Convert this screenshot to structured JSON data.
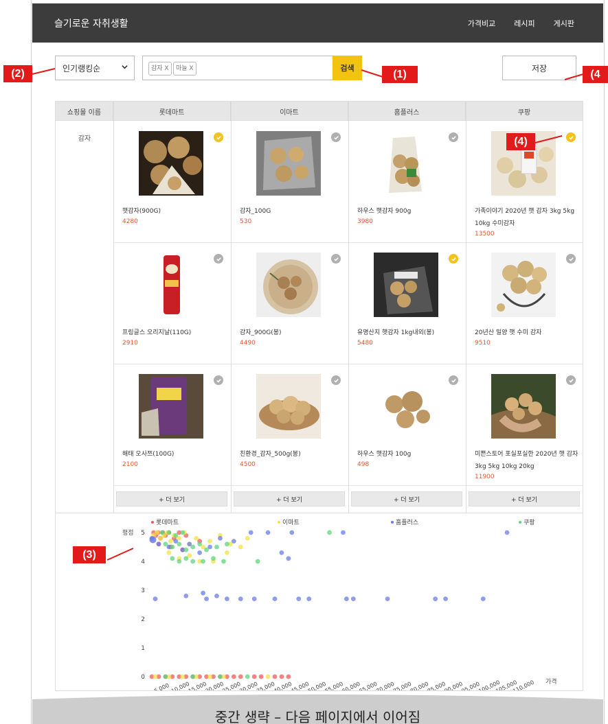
{
  "header": {
    "title": "슬기로운 자취생활",
    "nav": [
      "가격비교",
      "레시피",
      "게시판"
    ]
  },
  "toolbar": {
    "sort_value": "인기랭킹순",
    "tags": [
      "감자 X",
      "마늘 X"
    ],
    "search_label": "검색",
    "save_label": "저장"
  },
  "callouts": {
    "c1": "(1)",
    "c2": "(2)",
    "c3": "(3)",
    "c4": "(4)",
    "c4_right": "(4"
  },
  "table": {
    "headers": [
      "쇼핑몰 이름",
      "롯데마트",
      "이마트",
      "홈플러스",
      "쿠팡"
    ],
    "row_label": "감자",
    "more_label": "+ 더 보기",
    "products": [
      [
        {
          "name": "햇감자(900G)",
          "price": "4280",
          "checked": true
        },
        {
          "name": "감자_100G",
          "price": "530",
          "checked": false
        },
        {
          "name": "하우스 햇감자 900g",
          "price": "3980",
          "checked": false
        },
        {
          "name": "가족이야기 2020년 햇 감자 3kg 5kg 10kg 수미감자",
          "price": "13500",
          "checked": true
        }
      ],
      [
        {
          "name": "프링글스 오리지날(110G)",
          "price": "2910",
          "checked": false
        },
        {
          "name": "감자_900G(봉)",
          "price": "4490",
          "checked": false
        },
        {
          "name": "유명산지 햇감자 1kg내외(봉)",
          "price": "5480",
          "checked": true
        },
        {
          "name": "20년산 밀양 햇 수미 감자",
          "price": "9510",
          "checked": false
        }
      ],
      [
        {
          "name": "해태 오사쯔(100G)",
          "price": "2100",
          "checked": false
        },
        {
          "name": "친환경_감자_500g(봉)",
          "price": "4500",
          "checked": false
        },
        {
          "name": "하우스 햇감자 100g",
          "price": "498",
          "checked": false
        },
        {
          "name": "미쁜스토어 포실포실한 2020년 햇 감자 3kg 5kg 10kg 20kg",
          "price": "11900",
          "checked": false
        }
      ]
    ]
  },
  "colors": {
    "accent": "#f2c311",
    "header_bg": "#3c3c3c",
    "callout": "#e21a1a",
    "price": "#e4572e"
  },
  "chart_data": {
    "type": "scatter",
    "ylabel": "평점",
    "xlabel": "가격",
    "ylim": [
      0,
      5
    ],
    "xlim": [
      5000,
      110000
    ],
    "x_ticks": [
      5000,
      10000,
      15000,
      20000,
      25000,
      30000,
      35000,
      40000,
      45000,
      50000,
      55000,
      60000,
      65000,
      70000,
      75000,
      80000,
      85000,
      90000,
      95000,
      100000,
      105000,
      110000
    ],
    "x_tick_labels": [
      "5,000",
      "10,000",
      "15,000",
      "20,000",
      "25,000",
      "30,000",
      "35,000",
      "40,000",
      "45,000",
      "50,000",
      "55,000",
      "60,000",
      "65,000",
      "70,000",
      "75,000",
      "80,000",
      "85,000",
      "90,000",
      "95,000",
      "100,000",
      "105,000",
      "110,000"
    ],
    "y_ticks": [
      0,
      1,
      2,
      3,
      4,
      5
    ],
    "legend_placement": "top",
    "series": [
      {
        "name": "롯데마트",
        "color": "#f05a5a",
        "points": [
          [
            4500,
            5
          ],
          [
            5200,
            4.9
          ],
          [
            5800,
            5
          ],
          [
            6500,
            4.8
          ],
          [
            7200,
            5
          ],
          [
            8000,
            4.9
          ],
          [
            9000,
            5
          ],
          [
            10500,
            4.8
          ],
          [
            12000,
            5
          ],
          [
            14000,
            4.9
          ],
          [
            6000,
            4.6
          ],
          [
            9500,
            4.5
          ],
          [
            13000,
            4.4
          ],
          [
            18000,
            4.7
          ],
          [
            4000,
            0
          ],
          [
            6000,
            0
          ],
          [
            8000,
            0
          ],
          [
            10000,
            0
          ],
          [
            12000,
            0
          ],
          [
            14000,
            0
          ],
          [
            16000,
            0
          ],
          [
            18000,
            0
          ],
          [
            20000,
            0
          ],
          [
            22000,
            0
          ],
          [
            24000,
            0
          ],
          [
            26000,
            0
          ],
          [
            28000,
            0
          ],
          [
            30000,
            0
          ],
          [
            34000,
            0
          ],
          [
            36000,
            0
          ],
          [
            40000,
            0
          ],
          [
            42000,
            0
          ],
          [
            44000,
            0
          ]
        ]
      },
      {
        "name": "이마트",
        "color": "#f5e246",
        "points": [
          [
            4500,
            4.9
          ],
          [
            5500,
            5
          ],
          [
            6500,
            4.8
          ],
          [
            7500,
            4.9
          ],
          [
            8500,
            5
          ],
          [
            9500,
            4.7
          ],
          [
            10500,
            4.9
          ],
          [
            12000,
            4.8
          ],
          [
            13500,
            5
          ],
          [
            15000,
            4.6
          ],
          [
            17000,
            4.8
          ],
          [
            19000,
            4.5
          ],
          [
            21000,
            4.7
          ],
          [
            24000,
            4.9
          ],
          [
            27000,
            4.6
          ],
          [
            30000,
            4.5
          ],
          [
            32000,
            4.8
          ],
          [
            9000,
            4.3
          ],
          [
            12000,
            4.1
          ],
          [
            15000,
            4.2
          ],
          [
            18000,
            4.0
          ],
          [
            22000,
            4.0
          ],
          [
            26000,
            4.3
          ],
          [
            5000,
            0
          ],
          [
            9000,
            0
          ],
          [
            13000,
            0
          ],
          [
            17000,
            0
          ],
          [
            21000,
            0
          ],
          [
            25000,
            0
          ],
          [
            38000,
            0
          ]
        ]
      },
      {
        "name": "홈플러스",
        "color": "#6b7be8",
        "points": [
          [
            4000,
            4.8
          ],
          [
            6000,
            4.6
          ],
          [
            9000,
            4.5
          ],
          [
            11000,
            4.7
          ],
          [
            13000,
            4.4
          ],
          [
            15000,
            4.6
          ],
          [
            18000,
            4.3
          ],
          [
            21000,
            4.5
          ],
          [
            24000,
            4.8
          ],
          [
            28000,
            4.7
          ],
          [
            33000,
            5
          ],
          [
            38000,
            5
          ],
          [
            45000,
            5
          ],
          [
            60000,
            5
          ],
          [
            42000,
            4.3
          ],
          [
            44000,
            4.1
          ],
          [
            108000,
            5
          ],
          [
            5000,
            2.7
          ],
          [
            14000,
            2.8
          ],
          [
            19000,
            2.9
          ],
          [
            20000,
            2.7
          ],
          [
            23000,
            2.8
          ],
          [
            26000,
            2.7
          ],
          [
            30000,
            2.7
          ],
          [
            34000,
            2.7
          ],
          [
            40000,
            2.7
          ],
          [
            47000,
            2.7
          ],
          [
            50000,
            2.7
          ],
          [
            61000,
            2.7
          ],
          [
            63000,
            2.7
          ],
          [
            73000,
            2.7
          ],
          [
            87000,
            2.7
          ],
          [
            90000,
            2.7
          ],
          [
            101000,
            2.7
          ]
        ]
      },
      {
        "name": "쿠팡",
        "color": "#5ed67c",
        "points": [
          [
            7000,
            5
          ],
          [
            9000,
            5
          ],
          [
            11000,
            4.9
          ],
          [
            13000,
            5
          ],
          [
            8000,
            4.6
          ],
          [
            10000,
            4.5
          ],
          [
            12000,
            4.6
          ],
          [
            14000,
            4.4
          ],
          [
            16000,
            4.5
          ],
          [
            18000,
            4.6
          ],
          [
            20000,
            4.4
          ],
          [
            23000,
            4.5
          ],
          [
            26000,
            4.6
          ],
          [
            10000,
            4.1
          ],
          [
            12000,
            4.0
          ],
          [
            14000,
            4.1
          ],
          [
            16000,
            4.0
          ],
          [
            19000,
            4.0
          ],
          [
            22000,
            4.1
          ],
          [
            25000,
            4.0
          ],
          [
            35000,
            4.0
          ],
          [
            56000,
            5
          ],
          [
            8000,
            0
          ],
          [
            16000,
            0
          ],
          [
            24000,
            0
          ],
          [
            32000,
            0
          ]
        ]
      }
    ]
  },
  "footer": {
    "notice": "중간 생략 – 다음 페이지에서 이어짐"
  }
}
